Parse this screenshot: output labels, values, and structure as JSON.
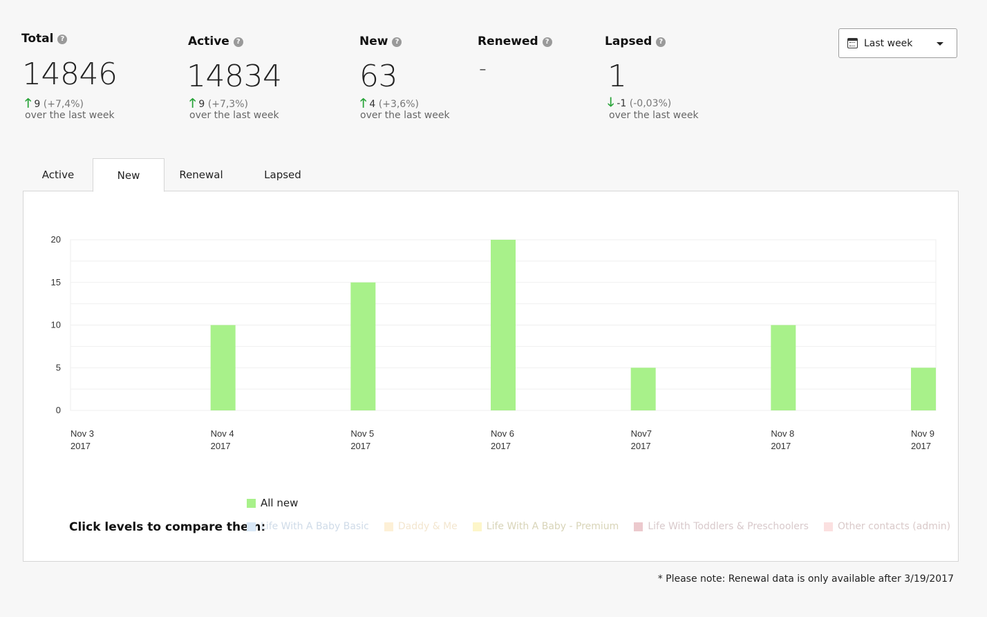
{
  "stats": [
    {
      "title": "Total",
      "value": "14846",
      "arrow": "up",
      "change": "9",
      "pct": "(+7,4%)",
      "note": "over the last week"
    },
    {
      "title": "Active",
      "value": "14834",
      "arrow": "up",
      "change": "9",
      "pct": "(+7,3%)",
      "note": "over the last week"
    },
    {
      "title": "New",
      "value": "63",
      "arrow": "up",
      "change": "4",
      "pct": "(+3,6%)",
      "note": "over the last week"
    },
    {
      "title": "Renewed",
      "value": "-"
    },
    {
      "title": "Lapsed",
      "value": "1",
      "arrow": "down",
      "change": "-1",
      "pct": "(-0,03%)",
      "note": "over the last week"
    }
  ],
  "help_icon_glyph": "?",
  "arrow_up_glyph": "🡑",
  "arrow_down_glyph": "🡓",
  "range_select": {
    "label": "Last week",
    "icon": "calendar-icon"
  },
  "tabs": [
    {
      "label": "Active",
      "active": false
    },
    {
      "label": "New",
      "active": true
    },
    {
      "label": "Renewal",
      "active": false
    },
    {
      "label": "Lapsed",
      "active": false
    }
  ],
  "chart_data": {
    "type": "bar",
    "categories": [
      [
        "Nov 3",
        "2017"
      ],
      [
        "Nov 4",
        "2017"
      ],
      [
        "Nov 5",
        "2017"
      ],
      [
        "Nov 6",
        "2017"
      ],
      [
        "Nov7",
        "2017"
      ],
      [
        "Nov 8",
        "2017"
      ],
      [
        "Nov 9",
        "2017"
      ]
    ],
    "series": [
      {
        "name": "All new",
        "color": "#a8f18a",
        "values": [
          0,
          10,
          15,
          20,
          5,
          10,
          5
        ]
      }
    ],
    "y_ticks": [
      0,
      5,
      10,
      15,
      20
    ],
    "ylim": [
      0,
      20
    ],
    "grid": true,
    "legend_position": "bottom"
  },
  "legend": {
    "label": "All new",
    "color": "#a8f18a"
  },
  "compare": {
    "label": "Click levels to compare them:",
    "levels": [
      {
        "label": "Life With A Baby Basic",
        "color": "#d9e8f7",
        "text_color": "#cfdbe8"
      },
      {
        "label": "Daddy & Me",
        "color": "#fdf0d6",
        "text_color": "#f3e6cf"
      },
      {
        "label": "Life With A Baby - Premium",
        "color": "#fdf6c9",
        "text_color": "#d8d4b8"
      },
      {
        "label": "Life With Toddlers & Preschoolers",
        "color": "#ecc9cd",
        "text_color": "#d8c9cb"
      },
      {
        "label": "Other contacts (admin)",
        "color": "#fbe0e0",
        "text_color": "#d9c9c9"
      }
    ]
  },
  "footnote": "* Please note: Renewal data is only available after 3/19/2017"
}
